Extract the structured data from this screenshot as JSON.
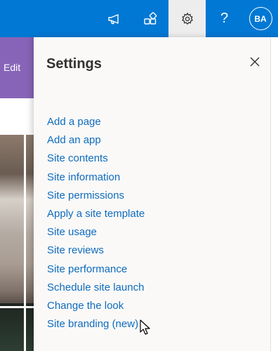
{
  "suitebar": {
    "avatar_initials": "BA",
    "help_glyph": "?",
    "icons": [
      "megaphone-icon",
      "apps-icon",
      "gear-icon",
      "help-icon"
    ],
    "accent_color": "#0078d4"
  },
  "page": {
    "edit_label": "Edit",
    "edit_bar_color": "#8764b8"
  },
  "settings": {
    "title": "Settings",
    "close_icon": "close-icon",
    "items": [
      {
        "label": "Add a page"
      },
      {
        "label": "Add an app"
      },
      {
        "label": "Site contents"
      },
      {
        "label": "Site information"
      },
      {
        "label": "Site permissions"
      },
      {
        "label": "Apply a site template"
      },
      {
        "label": "Site usage"
      },
      {
        "label": "Site reviews"
      },
      {
        "label": "Site performance"
      },
      {
        "label": "Schedule site launch"
      },
      {
        "label": "Change the look"
      },
      {
        "label": "Site branding (new)"
      }
    ]
  }
}
